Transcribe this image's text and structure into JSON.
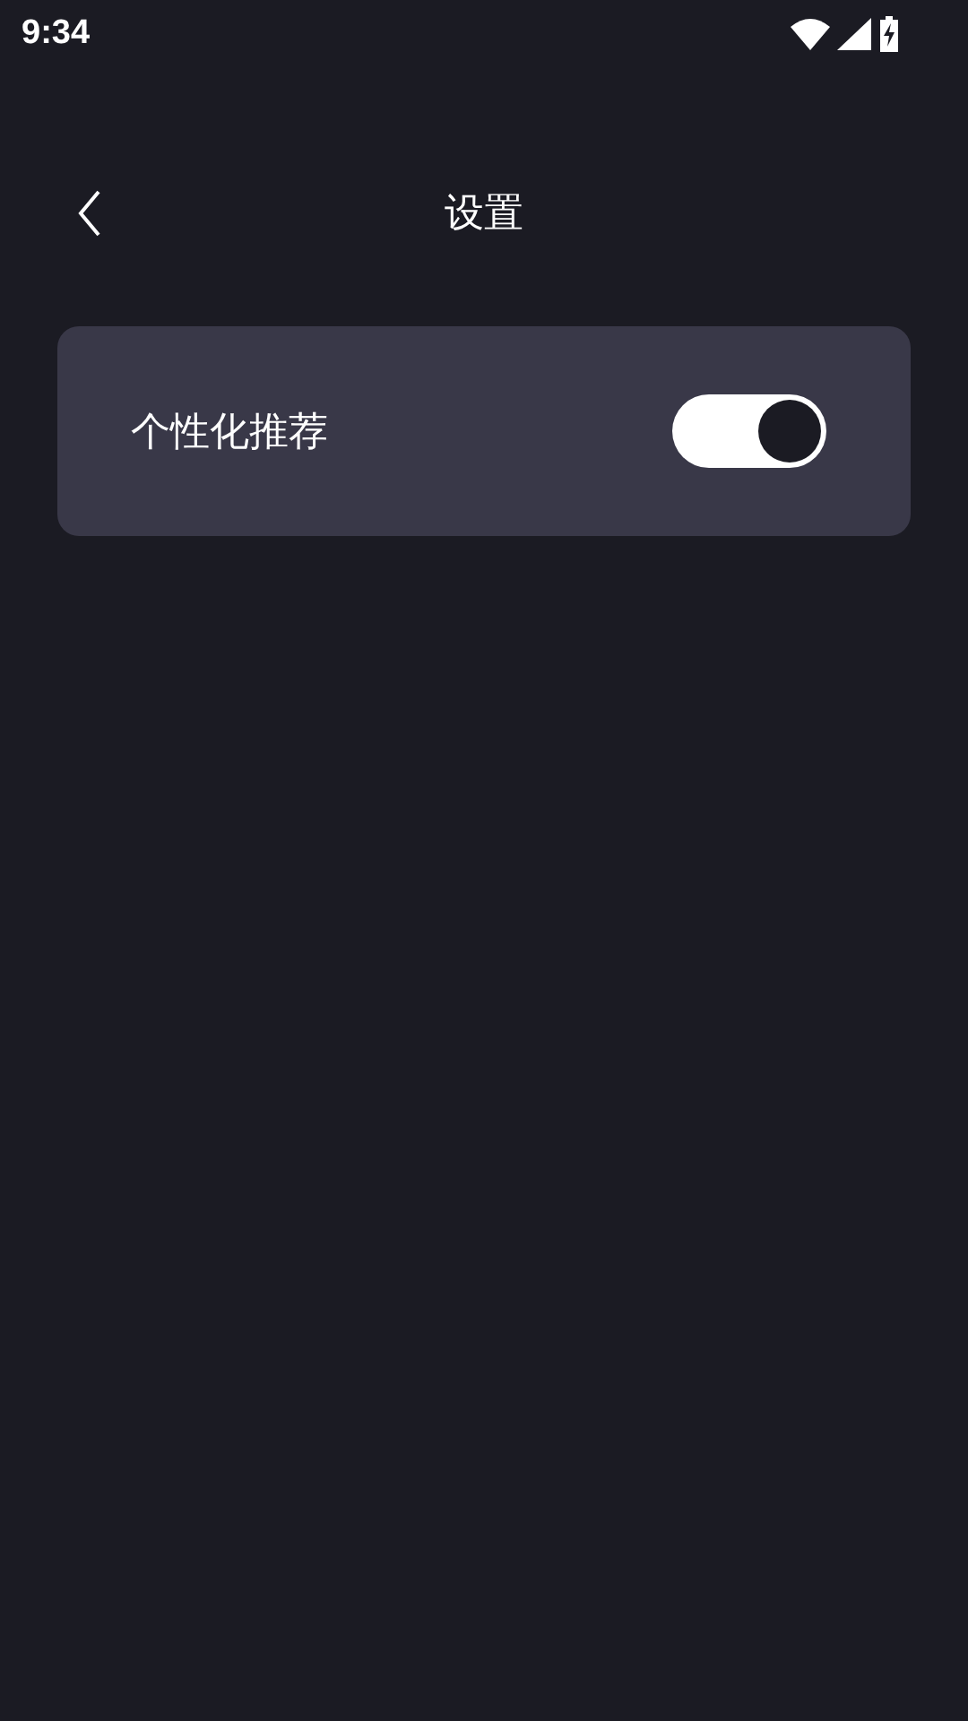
{
  "status_bar": {
    "time": "9:34"
  },
  "header": {
    "title": "设置"
  },
  "settings": [
    {
      "label": "个性化推荐",
      "kind": "toggle",
      "on": true
    }
  ]
}
